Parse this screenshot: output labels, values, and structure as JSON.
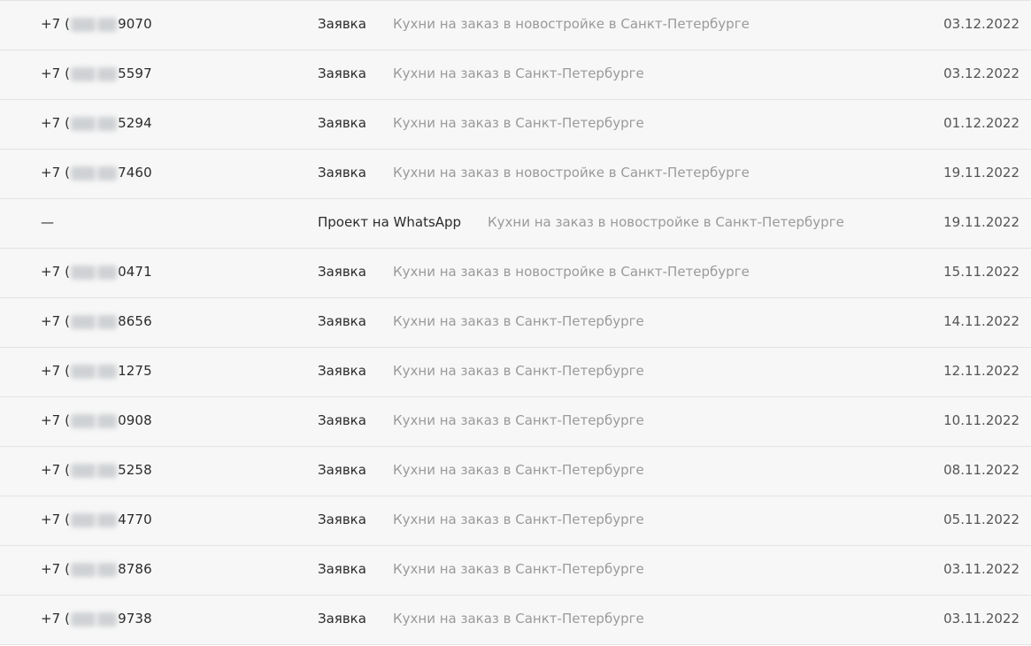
{
  "rows": [
    {
      "phone_prefix": "+7 (",
      "phone_suffix": "9070",
      "masked": true,
      "type": "Заявка",
      "source": "Кухни на заказ в новостройке в Санкт-Петербурге",
      "date": "03.12.2022"
    },
    {
      "phone_prefix": "+7 (",
      "phone_suffix": "5597",
      "masked": true,
      "type": "Заявка",
      "source": "Кухни на заказ в Санкт-Петербурге",
      "date": "03.12.2022"
    },
    {
      "phone_prefix": "+7 (",
      "phone_suffix": "5294",
      "masked": true,
      "type": "Заявка",
      "source": "Кухни на заказ в Санкт-Петербурге",
      "date": "01.12.2022"
    },
    {
      "phone_prefix": "+7 (",
      "phone_suffix": "7460",
      "masked": true,
      "type": "Заявка",
      "source": "Кухни на заказ в новостройке в Санкт-Петербурге",
      "date": "19.11.2022"
    },
    {
      "phone_prefix": "—",
      "phone_suffix": "",
      "masked": false,
      "type": "Проект на WhatsApp",
      "source": "Кухни на заказ в новостройке в Санкт-Петербурге",
      "date": "19.11.2022"
    },
    {
      "phone_prefix": "+7 (",
      "phone_suffix": "0471",
      "masked": true,
      "type": "Заявка",
      "source": "Кухни на заказ в новостройке в Санкт-Петербурге",
      "date": "15.11.2022"
    },
    {
      "phone_prefix": "+7 (",
      "phone_suffix": "8656",
      "masked": true,
      "type": "Заявка",
      "source": "Кухни на заказ в Санкт-Петербурге",
      "date": "14.11.2022"
    },
    {
      "phone_prefix": "+7 (",
      "phone_suffix": "1275",
      "masked": true,
      "type": "Заявка",
      "source": "Кухни на заказ в Санкт-Петербурге",
      "date": "12.11.2022"
    },
    {
      "phone_prefix": "+7 (",
      "phone_suffix": "0908",
      "masked": true,
      "type": "Заявка",
      "source": "Кухни на заказ в Санкт-Петербурге",
      "date": "10.11.2022"
    },
    {
      "phone_prefix": "+7 (",
      "phone_suffix": "5258",
      "masked": true,
      "type": "Заявка",
      "source": "Кухни на заказ в Санкт-Петербурге",
      "date": "08.11.2022"
    },
    {
      "phone_prefix": "+7 (",
      "phone_suffix": "4770",
      "masked": true,
      "type": "Заявка",
      "source": "Кухни на заказ в Санкт-Петербурге",
      "date": "05.11.2022"
    },
    {
      "phone_prefix": "+7 (",
      "phone_suffix": "8786",
      "masked": true,
      "type": "Заявка",
      "source": "Кухни на заказ в Санкт-Петербурге",
      "date": "03.11.2022"
    },
    {
      "phone_prefix": "+7 (",
      "phone_suffix": "9738",
      "masked": true,
      "type": "Заявка",
      "source": "Кухни на заказ в Санкт-Петербурге",
      "date": "03.11.2022"
    }
  ],
  "colors": {
    "row_background": "#f7f7f7",
    "divider": "#e3e3e3",
    "primary_text": "#2b2b2b",
    "secondary_text": "#9a9a9a",
    "date_text": "#555555"
  }
}
